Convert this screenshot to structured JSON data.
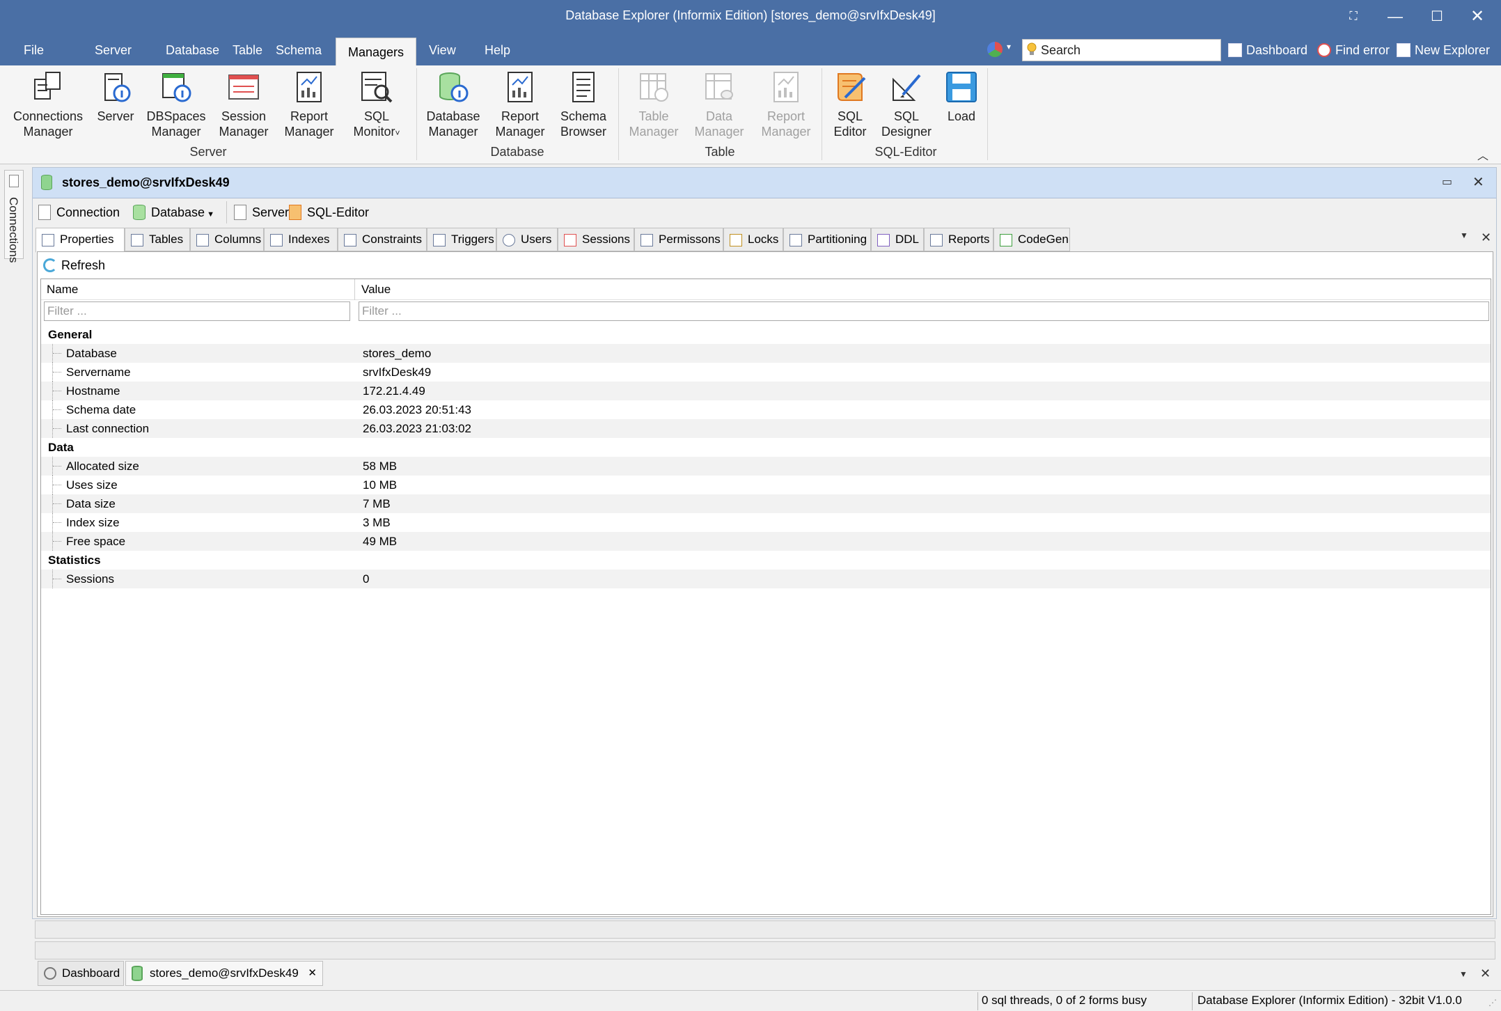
{
  "window": {
    "title": "Database Explorer (Informix Edition) [stores_demo@srvIfxDesk49]"
  },
  "menu": [
    "File",
    "Server",
    "Database",
    "Table",
    "Schema",
    "Managers",
    "View",
    "Help"
  ],
  "active_menu": "Managers",
  "search": {
    "placeholder": "Search"
  },
  "quicklinks": {
    "dashboard": "Dashboard",
    "find_error": "Find error",
    "new_explorer": "New Explorer"
  },
  "ribbon": {
    "groups": {
      "server": "Server",
      "database": "Database",
      "table": "Table",
      "sql_editor": "SQL-Editor"
    },
    "buttons": {
      "connections_manager": [
        "Connections",
        "Manager"
      ],
      "server": [
        "Server",
        ""
      ],
      "dbspaces_manager": [
        "DBSpaces",
        "Manager"
      ],
      "session_manager": [
        "Session",
        "Manager"
      ],
      "report_manager": [
        "Report",
        "Manager"
      ],
      "sql_monitor": [
        "SQL",
        "Monitor"
      ],
      "database_manager": [
        "Database",
        "Manager"
      ],
      "report_manager_db": [
        "Report",
        "Manager"
      ],
      "schema_browser": [
        "Schema",
        "Browser"
      ],
      "table_manager": [
        "Table",
        "Manager"
      ],
      "data_manager": [
        "Data",
        "Manager"
      ],
      "report_manager_table": [
        "Report",
        "Manager"
      ],
      "sql_editor": [
        "SQL",
        "Editor"
      ],
      "sql_designer": [
        "SQL",
        "Designer"
      ],
      "load": [
        "Load",
        ""
      ]
    }
  },
  "side": {
    "connections_tab": "Connections"
  },
  "document": {
    "title": "stores_demo@srvIfxDesk49",
    "toolbar": {
      "connection": "Connection",
      "database": "Database",
      "server": "Server",
      "sql_editor": "SQL-Editor"
    },
    "tabs": [
      "Properties",
      "Tables",
      "Columns",
      "Indexes",
      "Constraints",
      "Triggers",
      "Users",
      "Sessions",
      "Permissons",
      "Locks",
      "Partitioning",
      "DDL",
      "Reports",
      "CodeGen"
    ],
    "refresh": "Refresh",
    "grid": {
      "headers": {
        "name": "Name",
        "value": "Value"
      },
      "filter_placeholder": "Filter ...",
      "rows": [
        {
          "cat": "General"
        },
        {
          "name": "Database",
          "value": "stores_demo"
        },
        {
          "name": "Servername",
          "value": "srvIfxDesk49"
        },
        {
          "name": "Hostname",
          "value": "172.21.4.49"
        },
        {
          "name": "Schema date",
          "value": "26.03.2023 20:51:43"
        },
        {
          "name": "Last connection",
          "value": "26.03.2023 21:03:02"
        },
        {
          "cat": "Data"
        },
        {
          "name": "Allocated size",
          "value": "58 MB"
        },
        {
          "name": "Uses size",
          "value": "10 MB"
        },
        {
          "name": "Data size",
          "value": "7 MB"
        },
        {
          "name": "Index size",
          "value": "3 MB"
        },
        {
          "name": "Free space",
          "value": "49 MB"
        },
        {
          "cat": "Statistics"
        },
        {
          "name": "Sessions",
          "value": "0"
        }
      ]
    }
  },
  "doc_tabs": {
    "dashboard": "Dashboard",
    "stores": "stores_demo@srvIfxDesk49"
  },
  "status": {
    "threads": "0 sql threads, 0 of 2 forms busy",
    "app": "Database Explorer (Informix Edition) - 32bit V1.0.0"
  },
  "colors": {
    "titlebar": "#4a6fa5",
    "doc_header": "#cfe0f5",
    "accent_orange": "#f0a030"
  }
}
